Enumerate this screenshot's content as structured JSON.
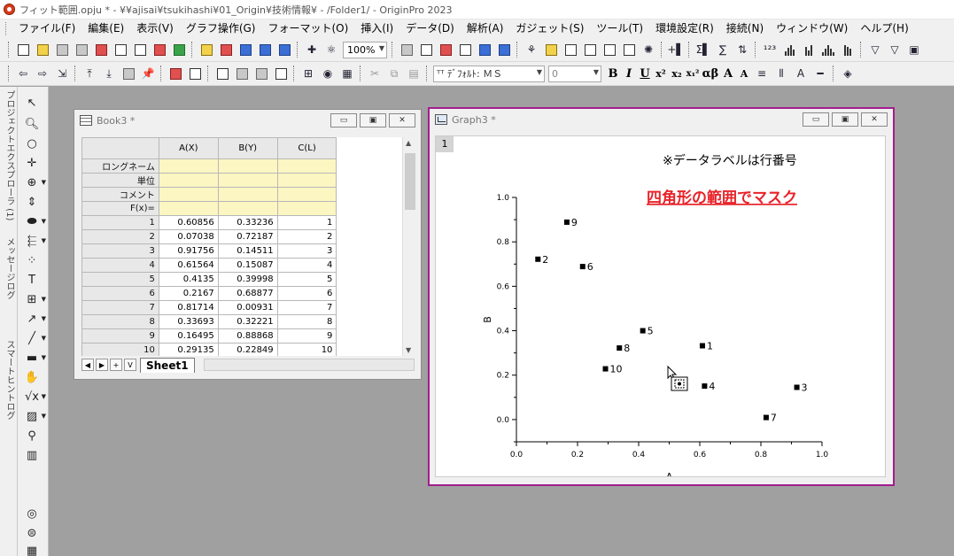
{
  "window": {
    "title": "フィット範囲.opju * - ¥¥ajisai¥tsukihashi¥01_Origin¥技術情報¥ - /Folder1/ - OriginPro 2023"
  },
  "menu": [
    "ファイル(F)",
    "編集(E)",
    "表示(V)",
    "グラフ操作(G)",
    "フォーマット(O)",
    "挿入(I)",
    "データ(D)",
    "解析(A)",
    "ガジェット(S)",
    "ツール(T)",
    "環境設定(R)",
    "接続(N)",
    "ウィンドウ(W)",
    "ヘルプ(H)"
  ],
  "toolbar": {
    "zoom": "100%",
    "font": "ᵀᵀ ﾃﾞﾌｫﾙﾄ: ＭＳ",
    "font_size": "0",
    "format_buttons": [
      "B",
      "I",
      "U",
      "x²",
      "x₂",
      "x₁²",
      "αβ",
      "A",
      "A"
    ]
  },
  "side_tabs": [
    "プロジェクトエクスプローラ (1)",
    "メッセージログ",
    "スマートヒントログ"
  ],
  "workbook": {
    "title": "Book3 *",
    "columns": [
      "A(X)",
      "B(Y)",
      "C(L)"
    ],
    "meta_rows": [
      "ロングネーム",
      "単位",
      "コメント",
      "F(x)="
    ],
    "rows": [
      [
        "1",
        "0.60856",
        "0.33236",
        "1"
      ],
      [
        "2",
        "0.07038",
        "0.72187",
        "2"
      ],
      [
        "3",
        "0.91756",
        "0.14511",
        "3"
      ],
      [
        "4",
        "0.61564",
        "0.15087",
        "4"
      ],
      [
        "5",
        "0.4135",
        "0.39998",
        "5"
      ],
      [
        "6",
        "0.2167",
        "0.68877",
        "6"
      ],
      [
        "7",
        "0.81714",
        "0.00931",
        "7"
      ],
      [
        "8",
        "0.33693",
        "0.32221",
        "8"
      ],
      [
        "9",
        "0.16495",
        "0.88868",
        "9"
      ],
      [
        "10",
        "0.29135",
        "0.22849",
        "10"
      ]
    ],
    "sheet_tab": "Sheet1"
  },
  "graph": {
    "title": "Graph3 *",
    "layer": "1",
    "note": "※データラベルは行番号",
    "mask_note": "四角形の範囲でマスク",
    "mask_color": "#e8232a",
    "window_border_color": "#a21d8e"
  },
  "chart_data": {
    "type": "scatter",
    "xlabel": "A",
    "ylabel": "B",
    "xlim": [
      0,
      1
    ],
    "ylim": [
      -0.1,
      1
    ],
    "xticks": [
      "0.0",
      "0.2",
      "0.4",
      "0.6",
      "0.8",
      "1.0"
    ],
    "yticks": [
      "0.0",
      "0.2",
      "0.4",
      "0.6",
      "0.8",
      "1.0"
    ],
    "series": [
      {
        "points": [
          {
            "x": 0.60856,
            "y": 0.33236,
            "label": "1"
          },
          {
            "x": 0.07038,
            "y": 0.72187,
            "label": "2"
          },
          {
            "x": 0.91756,
            "y": 0.14511,
            "label": "3"
          },
          {
            "x": 0.61564,
            "y": 0.15087,
            "label": "4"
          },
          {
            "x": 0.4135,
            "y": 0.39998,
            "label": "5"
          },
          {
            "x": 0.2167,
            "y": 0.68877,
            "label": "6"
          },
          {
            "x": 0.81714,
            "y": 0.00931,
            "label": "7"
          },
          {
            "x": 0.33693,
            "y": 0.32221,
            "label": "8"
          },
          {
            "x": 0.16495,
            "y": 0.88868,
            "label": "9"
          },
          {
            "x": 0.29135,
            "y": 0.22849,
            "label": "10"
          }
        ]
      }
    ]
  }
}
